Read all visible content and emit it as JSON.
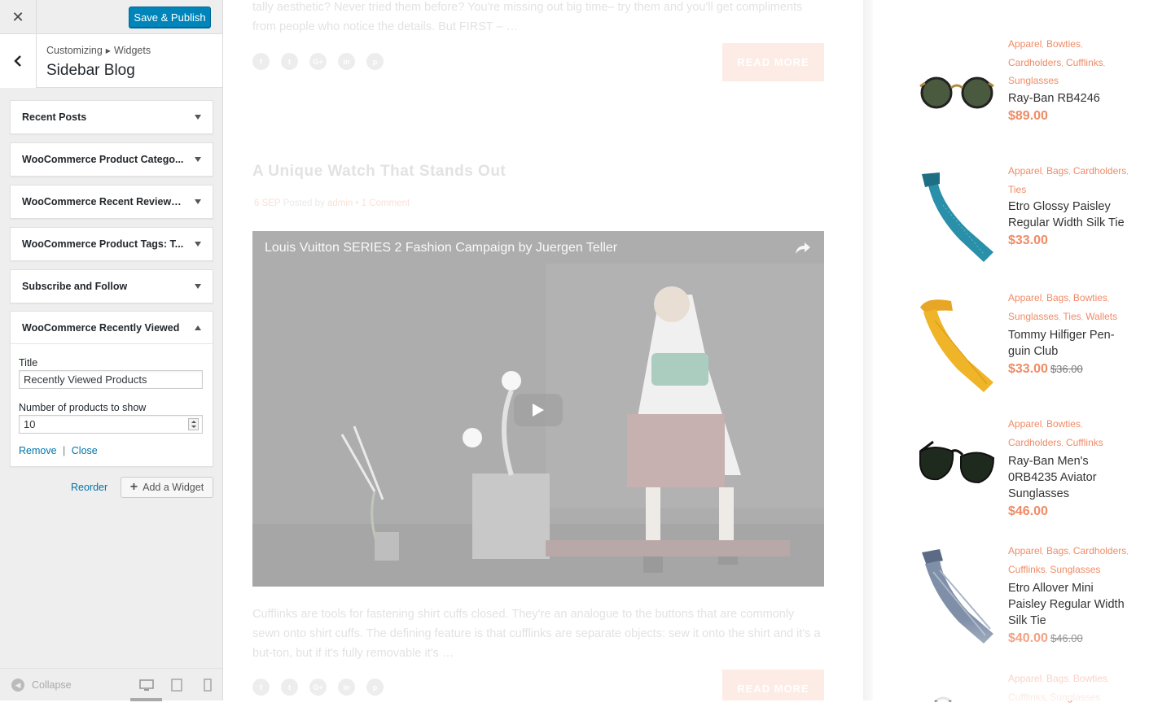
{
  "customizer": {
    "publish_label": "Save & Publish",
    "breadcrumb": [
      "Customizing",
      "Widgets"
    ],
    "section_title": "Sidebar Blog",
    "widgets": [
      {
        "title": "Recent Posts"
      },
      {
        "title": "WooCommerce Product Catego..."
      },
      {
        "title": "WooCommerce Recent Reviews..."
      },
      {
        "title": "WooCommerce Product Tags: T..."
      },
      {
        "title": "Subscribe and Follow"
      }
    ],
    "open_widget": {
      "title": "WooCommerce Recently Viewed",
      "title_label": "Title",
      "title_value": "Recently Viewed Products",
      "count_label": "Number of products to show",
      "count_value": "10",
      "remove_label": "Remove",
      "separator": "|",
      "close_label": "Close"
    },
    "reorder_label": "Reorder",
    "add_widget_label": "Add a Widget",
    "collapse_label": "Collapse"
  },
  "preview": {
    "top_excerpt": "tally aesthetic? Never tried them before? You're missing out big time– try them and you'll get compliments from people who notice the details. But FIRST – …",
    "read_more": "READ MORE",
    "post_title": "A Unique Watch That Stands Out",
    "post_date": "6 SEP",
    "posted_by": "Posted by",
    "author": "admin",
    "meta_sep": "•",
    "comments": "1 Comment",
    "video_title": "Louis Vuitton SERIES 2 Fashion Campaign by Juergen Teller",
    "bottom_excerpt": "Cufflinks are tools for fastening shirt cuffs closed. They're an analogue to the buttons that are commonly sewn onto shirt cuffs. The defining feature is that cufflinks are separate objects: sew it onto the shirt and it's a but-ton, but if it's fully removable it's …",
    "social_icons": [
      "f",
      "t",
      "G+",
      "in",
      "p"
    ]
  },
  "products": [
    {
      "cats": [
        "Apparel",
        "Bowties",
        "Cardholders",
        "Cufflinks",
        "Sunglasses"
      ],
      "name": "Ray-Ban RB4246",
      "price": "$89.00",
      "old": "",
      "icon": "round-sunglasses"
    },
    {
      "cats": [
        "Apparel",
        "Bags",
        "Cardholders",
        "Ties"
      ],
      "name": "Etro Glossy Paisley Regular Width Silk Tie",
      "price": "$33.00",
      "old": "",
      "icon": "teal-tie"
    },
    {
      "cats": [
        "Apparel",
        "Bags",
        "Bowties",
        "Sunglasses",
        "Ties",
        "Wallets"
      ],
      "name": "Tommy Hilfiger Pen-guin Club",
      "price": "$33.00",
      "old": "$36.00",
      "icon": "yellow-tie"
    },
    {
      "cats": [
        "Apparel",
        "Bowties",
        "Cardholders",
        "Cufflinks"
      ],
      "name": "Ray-Ban Men's 0RB4235 Aviator Sunglasses",
      "price": "$46.00",
      "old": "",
      "icon": "aviator-sunglasses"
    },
    {
      "cats": [
        "Apparel",
        "Bags",
        "Cardholders",
        "Cufflinks",
        "Sunglasses"
      ],
      "name": "Etro Allover Mini Paisley Regular Width Silk Tie",
      "price": "$40.00",
      "old": "$46.00",
      "icon": "grey-tie"
    },
    {
      "cats": [
        "Apparel",
        "Bags",
        "Bowties",
        "Cufflinks",
        "Sunglasses"
      ],
      "name": "",
      "price": "",
      "old": "",
      "icon": "sunglasses"
    }
  ],
  "colors": {
    "accent": "#f08b66",
    "publish": "#0085ba",
    "link": "#0073aa"
  }
}
